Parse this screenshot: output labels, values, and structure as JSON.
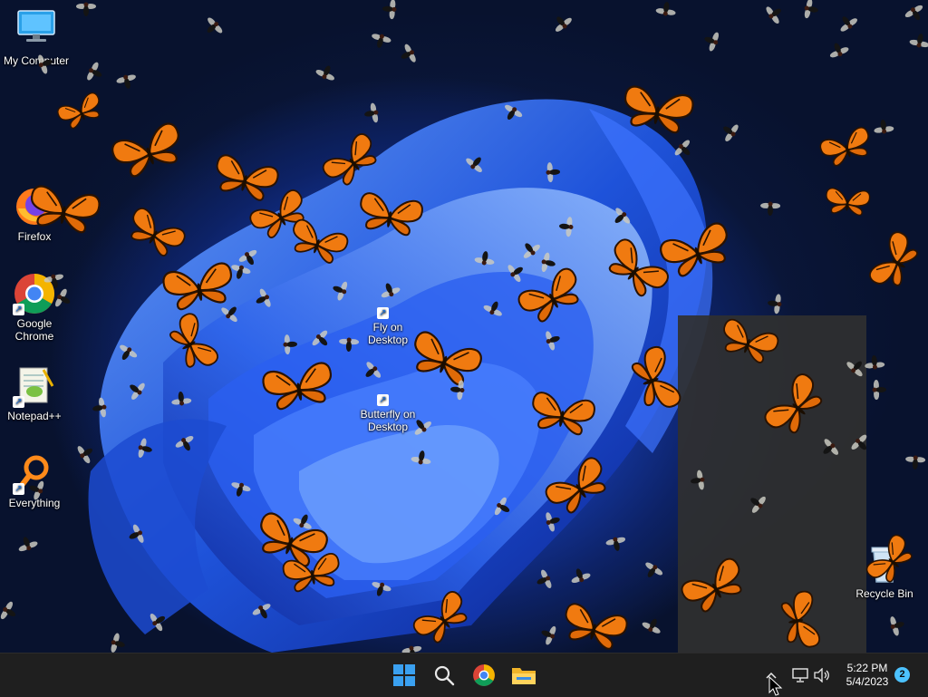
{
  "desktop": {
    "icons": [
      {
        "label": "My Computer",
        "icon": "monitor-icon",
        "shortcut": false
      },
      {
        "label": "Firefox",
        "icon": "firefox-icon",
        "shortcut": false
      },
      {
        "label": "Google Chrome",
        "icon": "chrome-icon",
        "shortcut": true
      },
      {
        "label": "Notepad++",
        "icon": "notepad-plus-plus-icon",
        "shortcut": true
      },
      {
        "label": "Everything",
        "icon": "everything-search-icon",
        "shortcut": true
      },
      {
        "label": "Fly on Desktop",
        "icon": "fly-on-desktop-icon",
        "shortcut": true
      },
      {
        "label": "Butterfly on Desktop",
        "icon": "butterfly-on-desktop-icon",
        "shortcut": true
      },
      {
        "label": "Recycle Bin",
        "icon": "recycle-bin-icon",
        "shortcut": false
      }
    ]
  },
  "taskbar": {
    "pinned": [
      {
        "name": "Start",
        "icon": "windows-start-icon"
      },
      {
        "name": "Search",
        "icon": "search-icon"
      },
      {
        "name": "Google Chrome",
        "icon": "chrome-icon"
      },
      {
        "name": "File Explorer",
        "icon": "file-explorer-icon"
      }
    ],
    "tray": {
      "icons": [
        "chevron-up-icon",
        "network-icon",
        "volume-icon"
      ],
      "time": "5:22 PM",
      "date": "5/4/2023",
      "notification_count": "2"
    }
  },
  "colors": {
    "taskbar_bg": "#1f1f1f",
    "butterfly_orange": "#f07a10",
    "accent": "#4cc2ff"
  }
}
